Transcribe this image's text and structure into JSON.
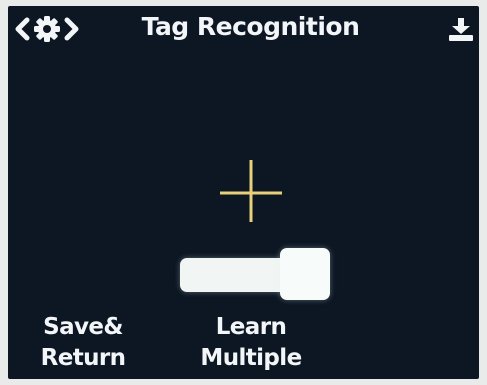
{
  "header": {
    "title": "Tag Recognition",
    "nav_icons": [
      "chevron-left-icon",
      "gear-icon",
      "chevron-right-icon"
    ],
    "action_icon": "download-icon"
  },
  "main": {
    "crosshair_icon": "crosshair-icon",
    "learn_multiple_toggle": {
      "state": "on"
    }
  },
  "footer": {
    "save_return_label_line1": "Save&",
    "save_return_label_line2": "Return",
    "learn_multiple_label_line1": "Learn",
    "learn_multiple_label_line2": "Multiple"
  },
  "colors": {
    "background": "#0d1623",
    "text": "#f3f6f8",
    "crosshair": "#e7d07a",
    "toggle": "#f1f5f3"
  }
}
